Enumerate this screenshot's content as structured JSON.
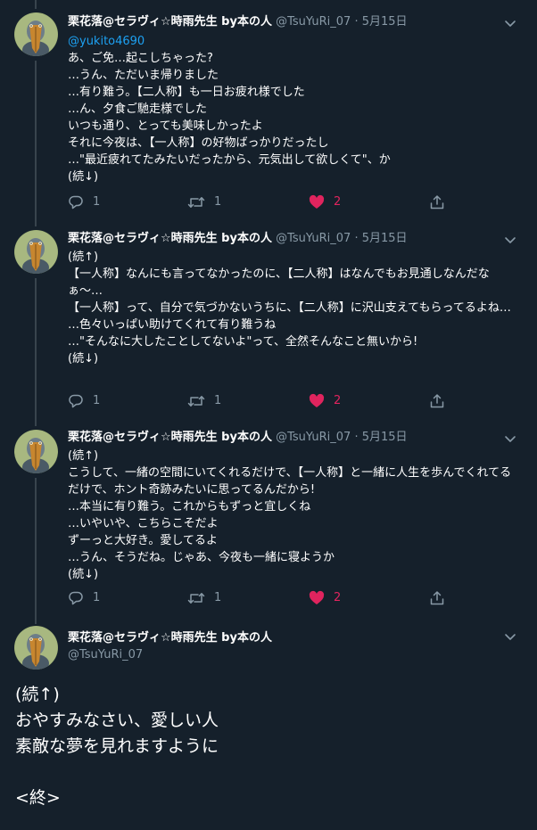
{
  "author": {
    "name": "栗花落@セラヴィ☆時雨先生 by本の人",
    "handle": "@TsuYuRi_07"
  },
  "tweets": [
    {
      "date": "5月15日",
      "mention": "@yukito4690",
      "lines": [
        "あ、ご免…起こしちゃった?",
        "…うん、ただいま帰りました",
        "…有り難う。【二人称】も一日お疲れ様でした",
        "…ん、夕食ご馳走様でした",
        "いつも通り、とっても美味しかったよ",
        "それに今夜は、【一人称】の好物ばっかりだったし",
        "…\"最近疲れてたみたいだったから、元気出して欲しくて\"、か",
        "(続↓)"
      ],
      "reply_count": "1",
      "retweet_count": "1",
      "like_count": "2"
    },
    {
      "date": "5月15日",
      "lines": [
        "(続↑)",
        "【一人称】なんにも言ってなかったのに、【二人称】はなんでもお見通しなんだなぁ〜…",
        "【一人称】って、自分で気づかないうちに、【二人称】に沢山支えてもらってるよね…",
        "…色々いっぱい助けてくれて有り難うね",
        "…\"そんなに大したことしてないよ\"って、全然そんなこと無いから!",
        "(続↓)"
      ],
      "reply_count": "1",
      "retweet_count": "1",
      "like_count": "2"
    },
    {
      "date": "5月15日",
      "lines": [
        "(続↑)",
        "こうして、一緒の空間にいてくれるだけで、【一人称】と一緒に人生を歩んでくれてるだけで、ホント奇跡みたいに思ってるんだから!",
        "…本当に有り難う。これからもずっと宜しくね",
        "…いやいや、こちらこそだよ",
        "ずーっと大好き。愛してるよ",
        "…うん、そうだね。じゃあ、今夜も一緒に寝ようか",
        "(続↓)"
      ],
      "reply_count": "1",
      "retweet_count": "1",
      "like_count": "2"
    }
  ],
  "final_tweet": {
    "lines": [
      "(続↑)",
      "おやすみなさい、愛しい人",
      "素敵な夢を見れますように",
      "",
      "<終>"
    ]
  },
  "colors": {
    "background": "#15202b",
    "secondary_text": "#8899a6",
    "link": "#1da1f2",
    "like": "#e0245e",
    "thread_line": "#38444d"
  },
  "icons": [
    "chevron-down-icon",
    "reply-icon",
    "retweet-icon",
    "heart-icon",
    "share-icon"
  ]
}
